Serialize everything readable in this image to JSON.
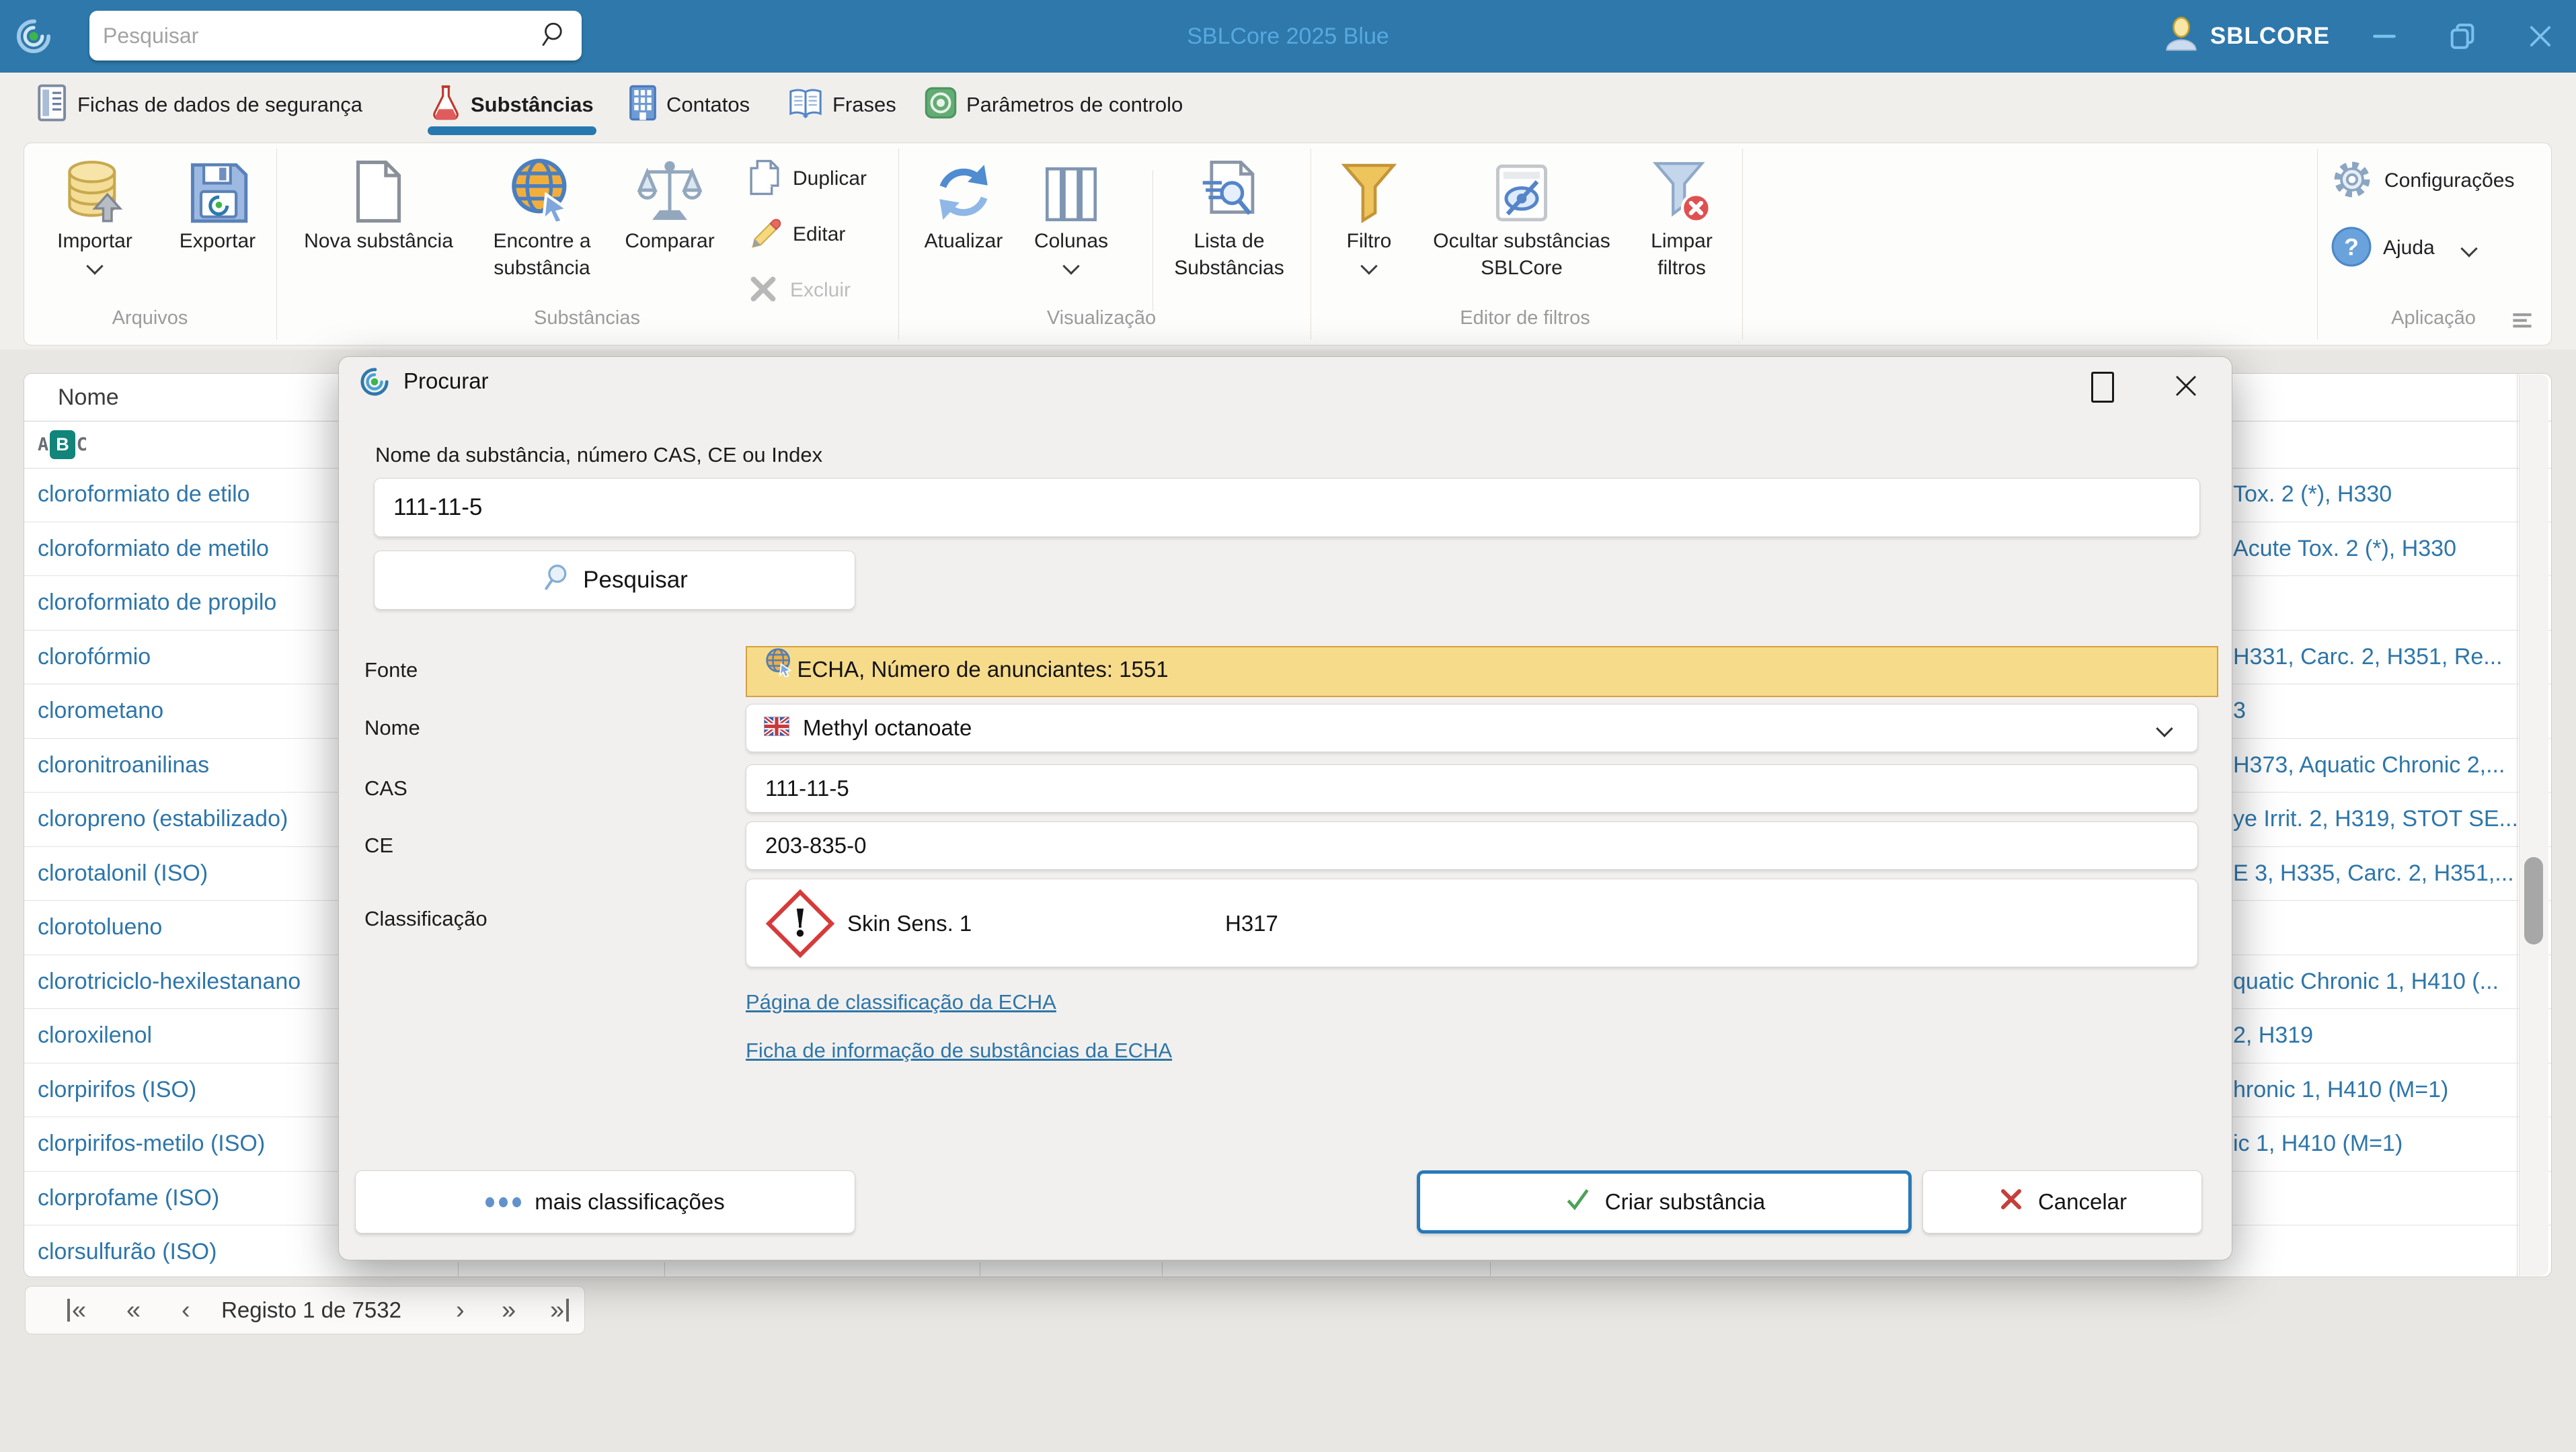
{
  "colors": {
    "titlebar": "#2e78ab",
    "title_text": "#57a9de",
    "accent": "#2878b0",
    "row_text": "#2e76a9",
    "fonte_bg": "#f6db8b",
    "fonte_border": "#d2a13e",
    "create_border": "#2979b8",
    "link": "#2e76a9"
  },
  "titlebar": {
    "search_placeholder": "Pesquisar",
    "title": "SBLCore 2025 Blue",
    "account_label": "SBLCORE"
  },
  "tabs": [
    {
      "label": "Fichas de dados de segurança"
    },
    {
      "label": "Substâncias",
      "active": true
    },
    {
      "label": "Contatos"
    },
    {
      "label": "Frases"
    },
    {
      "label": "Parâmetros de controlo"
    }
  ],
  "ribbon": {
    "groups": [
      {
        "label": "Arquivos"
      },
      {
        "label": "Substâncias"
      },
      {
        "label": "Visualização"
      },
      {
        "label": "Editor de filtros"
      },
      {
        "label": "Aplicação"
      }
    ],
    "items": {
      "importar": "Importar",
      "exportar": "Exportar",
      "nova": "Nova substância",
      "encontre_1": "Encontre a",
      "encontre_2": "substância",
      "comparar": "Comparar",
      "duplicar": "Duplicar",
      "editar": "Editar",
      "excluir": "Excluir",
      "atualizar": "Atualizar",
      "colunas": "Colunas",
      "lista_1": "Lista de",
      "lista_2": "Substâncias",
      "filtro": "Filtro",
      "ocultar_1": "Ocultar substâncias",
      "ocultar_2": "SBLCore",
      "limpar_1": "Limpar",
      "limpar_2": "filtros",
      "configuracoes": "Configurações",
      "ajuda": "Ajuda"
    }
  },
  "table": {
    "header": "Nome",
    "filter_letters": [
      "A",
      "B",
      "C"
    ],
    "rows": [
      {
        "name": "cloroformiato de etilo",
        "classification": "Tox. 2 (*), H330"
      },
      {
        "name": "cloroformiato de metilo",
        "classification": "Acute Tox. 2 (*), H330"
      },
      {
        "name": "cloroformiato de propilo",
        "classification": ""
      },
      {
        "name": "clorofórmio",
        "classification": "H331, Carc. 2, H351, Re..."
      },
      {
        "name": "clorometano",
        "classification": "3"
      },
      {
        "name": "cloronitroanilinas",
        "classification": "H373, Aquatic Chronic 2,..."
      },
      {
        "name": "cloropreno (estabilizado)",
        "classification": "ye Irrit. 2, H319, STOT SE..."
      },
      {
        "name": "clorotalonil (ISO)",
        "classification": "E 3, H335, Carc. 2, H351,..."
      },
      {
        "name": "clorotolueno",
        "classification": ""
      },
      {
        "name": "clorotriciclo-hexilestanano",
        "classification": "quatic Chronic 1, H410 (..."
      },
      {
        "name": "cloroxilenol",
        "classification": "2, H319"
      },
      {
        "name": "clorpirifos (ISO)",
        "classification": "hronic 1, H410 (M=1)"
      },
      {
        "name": "clorpirifos-metilo (ISO)",
        "classification": "ic 1, H410 (M=1)"
      },
      {
        "name": "clorprofame (ISO)",
        "classification": ""
      },
      {
        "name": "clorsulfurão (ISO)",
        "classification": ""
      }
    ]
  },
  "pagination": {
    "first_glyph": "«",
    "fast_prev_glyph": "«",
    "prev_glyph": "‹",
    "label": "Registo 1 de 7532",
    "next_glyph": "›",
    "fast_next_glyph": "»",
    "last_glyph": "»"
  },
  "dialog": {
    "title": "Procurar",
    "search_label": "Nome da substância, número CAS, CE ou Index",
    "search_value": "111-11-5",
    "search_button": "Pesquisar",
    "fields": {
      "fonte_label": "Fonte",
      "fonte_value": "ECHA, Número de anunciantes: 1551",
      "nome_label": "Nome",
      "nome_value": "Methyl octanoate",
      "cas_label": "CAS",
      "cas_value": "111-11-5",
      "ce_label": "CE",
      "ce_value": "203-835-0",
      "class_label": "Classificação",
      "class_value": "Skin Sens. 1",
      "class_code": "H317"
    },
    "links": {
      "classification_page": "Página de classificação da ECHA",
      "substance_infocard": "Ficha de informação de substâncias da ECHA"
    },
    "buttons": {
      "more": "mais classificações",
      "create": "Criar substância",
      "cancel": "Cancelar"
    }
  }
}
